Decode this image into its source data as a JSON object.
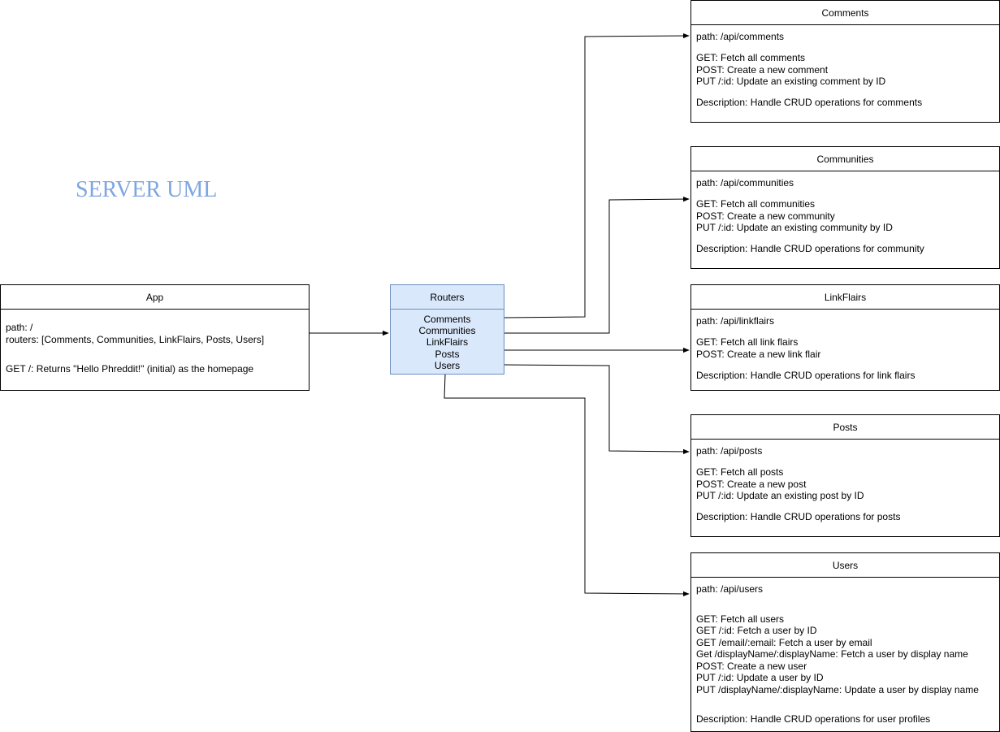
{
  "title": "SERVER UML",
  "app": {
    "name": "App",
    "path": "path: /",
    "routers": "routers: [Comments, Communities, LinkFlairs, Posts, Users]",
    "get": "GET /: Returns \"Hello Phreddit!\" (initial) as the homepage"
  },
  "routers": {
    "name": "Routers",
    "items": [
      "Comments",
      "Communities",
      "LinkFlairs",
      "Posts",
      "Users"
    ]
  },
  "comments": {
    "name": "Comments",
    "path": "path: /api/comments",
    "ops": [
      "GET: Fetch all comments",
      "POST: Create a new comment",
      "PUT /:id: Update an existing comment by ID"
    ],
    "description": "Description: Handle CRUD operations for comments"
  },
  "communities": {
    "name": "Communities",
    "path": "path: /api/communities",
    "ops": [
      "GET: Fetch all communities",
      "POST: Create a new community",
      "PUT /:id: Update an existing community by ID"
    ],
    "description": "Description: Handle CRUD operations for community"
  },
  "linkflairs": {
    "name": "LinkFlairs",
    "path": "path: /api/linkflairs",
    "ops": [
      "GET: Fetch all link flairs",
      "POST: Create a new link flair"
    ],
    "description": "Description: Handle CRUD operations for link flairs"
  },
  "posts": {
    "name": "Posts",
    "path": "path: /api/posts",
    "ops": [
      "GET: Fetch all posts",
      "POST: Create a new post",
      "PUT /:id: Update an existing post by ID"
    ],
    "description": "Description: Handle CRUD operations for posts"
  },
  "users": {
    "name": "Users",
    "path": "path: /api/users",
    "ops": [
      "GET: Fetch all users",
      "GET /:id: Fetch a user by ID",
      "GET /email/:email: Fetch a user by email",
      "Get /displayName/:displayName: Fetch a user by display name",
      "POST: Create a new user",
      "PUT /:id: Update a user by ID",
      "PUT /displayName/:displayName: Update a user by display name"
    ],
    "description": "Description: Handle CRUD operations for user profiles"
  },
  "colors": {
    "title": "#7ea6e0",
    "routers_fill": "#dae8fc",
    "routers_stroke": "#6c8ebf"
  }
}
